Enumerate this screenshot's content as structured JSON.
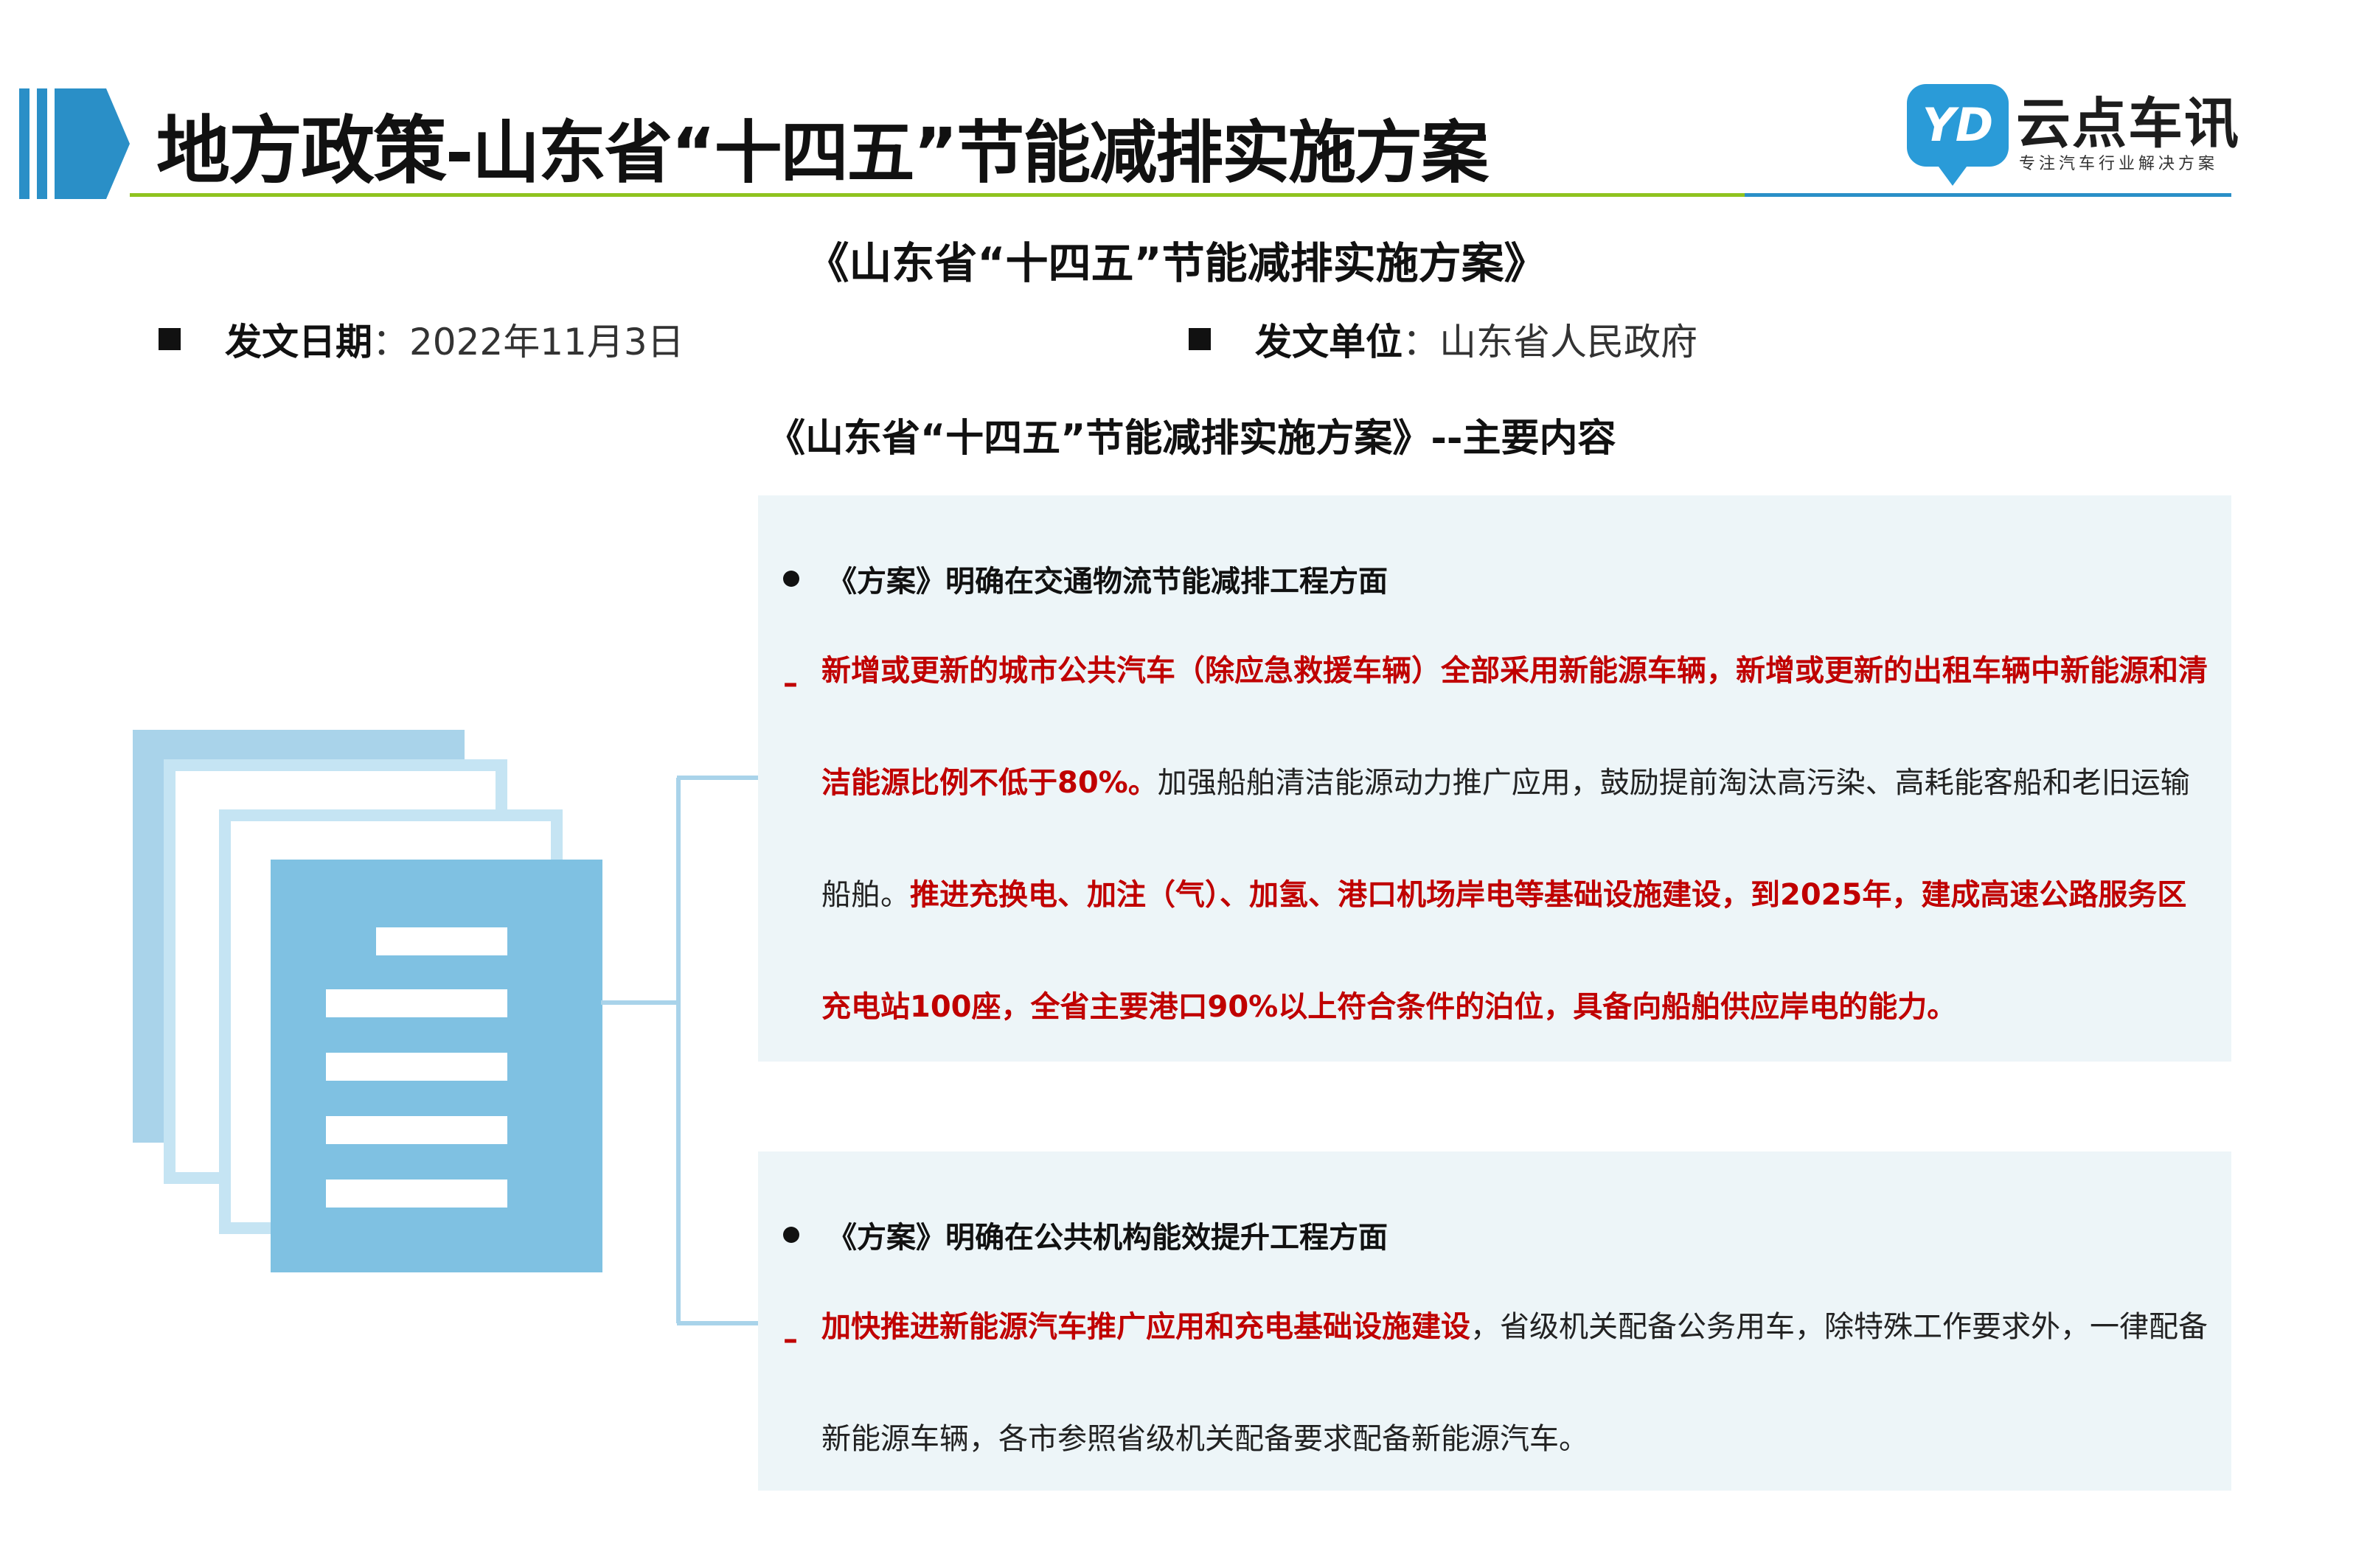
{
  "header": {
    "title_part1": "地方政策",
    "title_part2": "-山东省“十四五”节能减排实施方案",
    "accent_green": "#8fc31f",
    "accent_blue": "#2a8fc7"
  },
  "logo": {
    "mark": "YD",
    "name": "云点车讯",
    "tagline": "专注汽车行业解决方案"
  },
  "document": {
    "title": "《山东省“十四五”节能减排实施方案》",
    "date_label": "发文日期",
    "date_value": "：2022年11月3日",
    "issuer_label": "发文单位",
    "issuer_value": "：山东省人民政府",
    "content_heading": "《山东省“十四五”节能减排实施方案》--主要内容"
  },
  "sections": [
    {
      "heading": "《方案》明确在交通物流节能减排工程方面",
      "dash": "–",
      "p1_red": "新增或更新的城市公共汽车（除应急救援车辆）全部采用新能源车辆，新增或更新的出租车辆中新能源和清洁能源比例不低于80%。",
      "p1_normal": "加强船舶清洁能源动力推广应用，鼓励提前淘汰高污染、高耗能客船和老旧运输船舶。",
      "p1_red2": "推进充换电、加注（气）、加氢、港口机场岸电等基础设施建设，到2025年，建成高速公路服务区充电站100座，全省主要港口90%以上符合条件的泊位，具备向船舶供应岸电的能力。"
    },
    {
      "heading": "《方案》明确在公共机构能效提升工程方面",
      "dash": "–",
      "p1_red": "加快推进新能源汽车推广应用和充电基础设施建设",
      "p1_normal": "，省级机关配备公务用车，除特殊工作要求外，一律配备新能源车辆，各市参照省级机关配备要求配备新能源汽车。"
    }
  ]
}
